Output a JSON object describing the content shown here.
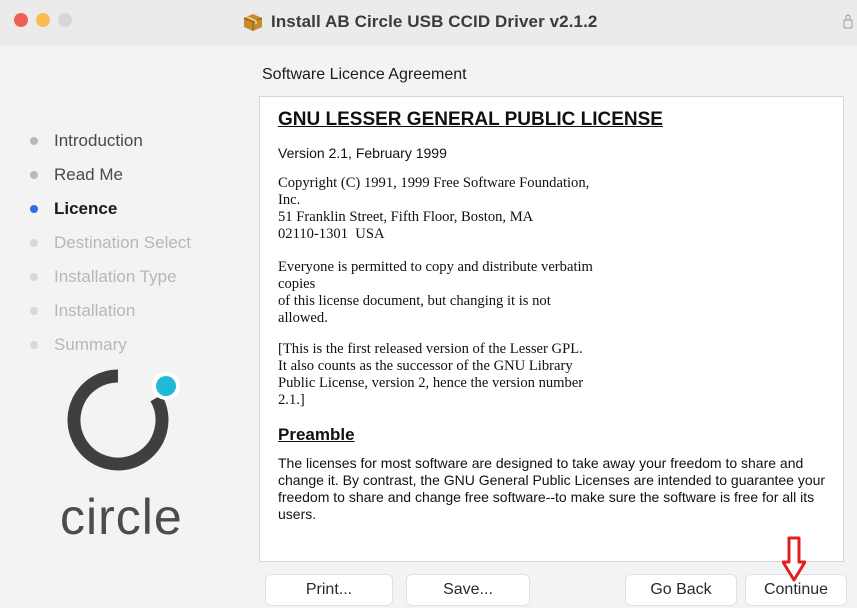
{
  "window": {
    "title": "Install AB Circle USB CCID Driver v2.1.2"
  },
  "section_title": "Software Licence Agreement",
  "sidebar": {
    "steps": [
      {
        "label": "Introduction",
        "state": "done"
      },
      {
        "label": "Read Me",
        "state": "done"
      },
      {
        "label": "Licence",
        "state": "active"
      },
      {
        "label": "Destination Select",
        "state": "pending"
      },
      {
        "label": "Installation Type",
        "state": "pending"
      },
      {
        "label": "Installation",
        "state": "pending"
      },
      {
        "label": "Summary",
        "state": "pending"
      }
    ],
    "logo_text": "circle"
  },
  "license": {
    "heading": "GNU LESSER GENERAL PUBLIC LICENSE",
    "version": "Version 2.1, February 1999",
    "copyright": "Copyright (C) 1991, 1999 Free Software Foundation,\nInc.\n51 Franklin Street, Fifth Floor, Boston, MA\n02110-1301  USA",
    "permission": "Everyone is permitted to copy and distribute verbatim\ncopies\nof this license document, but changing it is not\nallowed.",
    "note": "[This is the first released version of the Lesser GPL.\nIt also counts as the successor of the GNU Library\nPublic License, version 2, hence the version number\n2.1.]",
    "preamble_heading": "Preamble",
    "preamble_text": "The licenses for most software are designed to take away your freedom to share and change it. By contrast, the GNU General Public Licenses are intended to guarantee your freedom to share and change free software--to make sure the software is free for all its users."
  },
  "buttons": {
    "print": "Print...",
    "save": "Save...",
    "go_back": "Go Back",
    "continue": "Continue"
  },
  "colors": {
    "active_step": "#2e6ee6",
    "logo_accent": "#22b8d8",
    "arrow": "#e02020"
  }
}
